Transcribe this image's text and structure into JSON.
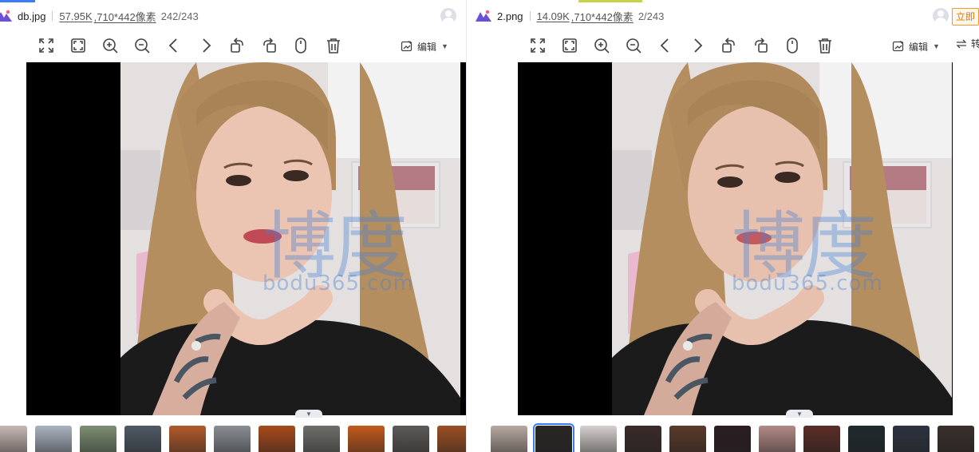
{
  "left_viewer": {
    "filename": "db.jpg",
    "file_size": "57.95K",
    "dimensions": ",710*442像素",
    "position": "242/243",
    "edit_label": "编辑",
    "toolbar_icons": [
      "fit-icon",
      "fullscreen-icon",
      "zoom-in-icon",
      "zoom-out-icon",
      "prev-icon",
      "next-icon",
      "rotate-left-icon",
      "rotate-right-icon",
      "mouse-icon",
      "delete-icon"
    ],
    "thumbnail_colors": [
      "#c9b7b4",
      "#aab3c0",
      "#7d8f73",
      "#4f5a66",
      "#b25a2a",
      "#8a8f95",
      "#a84a1c",
      "#6e6f6a",
      "#c45a1c",
      "#5c5a58",
      "#9d4f24"
    ]
  },
  "right_viewer": {
    "filename": "2.png",
    "file_size": "14.09K",
    "dimensions": ",710*442像素",
    "position": "2/243",
    "edit_label": "编辑",
    "open_label": "立即",
    "convert_label": "转",
    "toolbar_icons": [
      "fit-icon",
      "fullscreen-icon",
      "zoom-in-icon",
      "zoom-out-icon",
      "prev-icon",
      "next-icon",
      "rotate-left-icon",
      "rotate-right-icon",
      "mouse-icon",
      "delete-icon"
    ],
    "thumbnail_colors": [
      "#b8a8a0",
      "#2a2626",
      "#d6d0cf",
      "#3b2b2a",
      "#5a3a2a",
      "#2b1e22",
      "#b38a86",
      "#5a2e26",
      "#1f2a2e",
      "#2d3440",
      "#3a2f2a"
    ]
  },
  "watermark": {
    "text": "博度",
    "sub": "bodu365.com"
  },
  "colors": {
    "accent": "#3b7cf5",
    "logo_purple": "#6a4fd8",
    "open_orange": "#f29a2e"
  }
}
